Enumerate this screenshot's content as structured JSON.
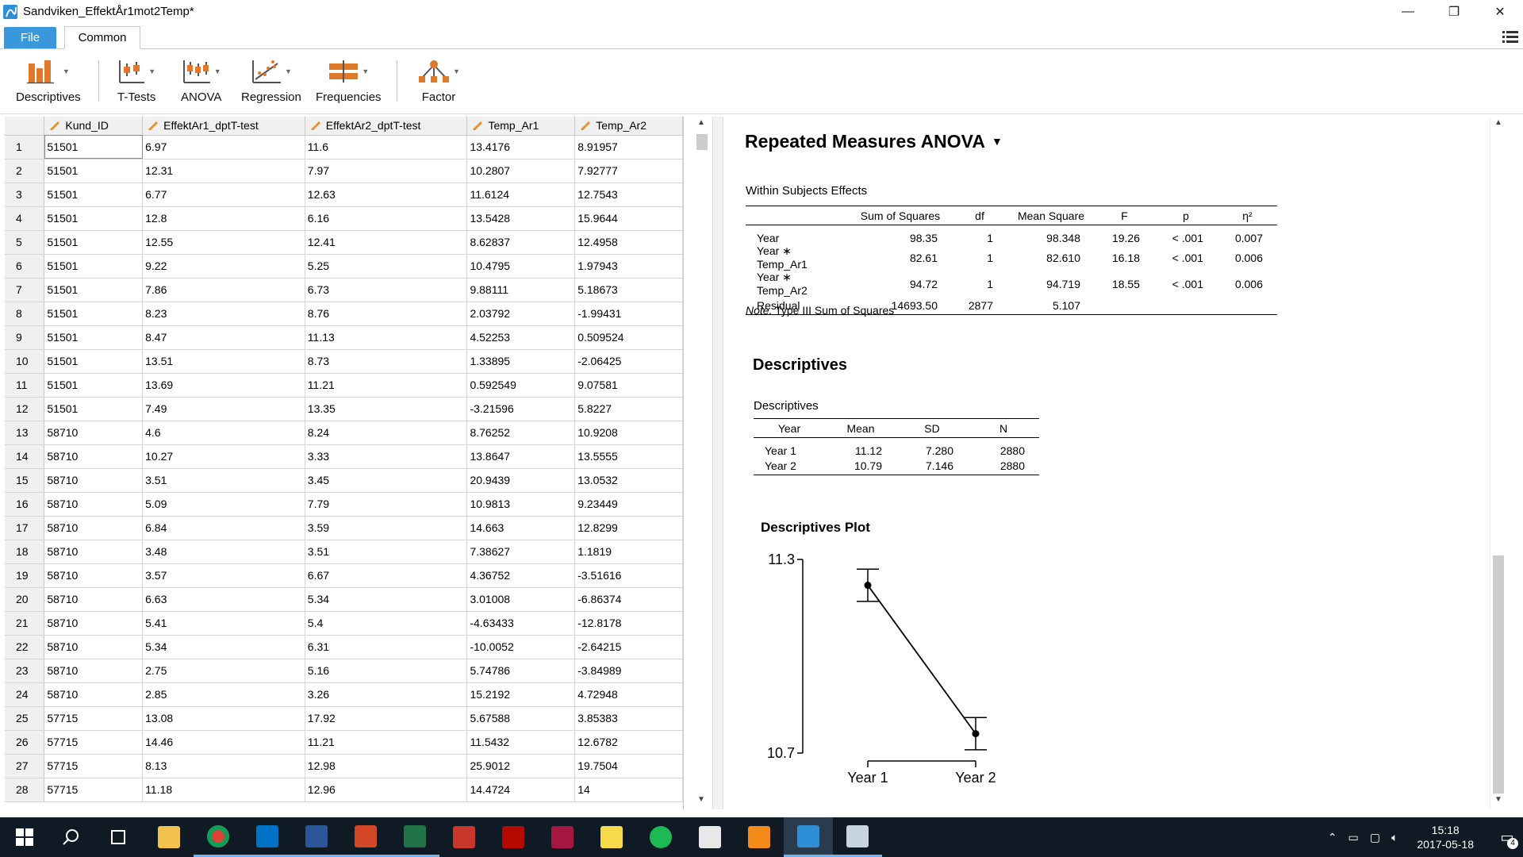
{
  "window": {
    "title": "Sandviken_EffektÅr1mot2Temp*",
    "minimize_glyph": "—",
    "maximize_glyph": "❐",
    "close_glyph": "✕"
  },
  "tabs": {
    "file": "File",
    "common": "Common"
  },
  "ribbon": {
    "descriptives": "Descriptives",
    "ttests": "T-Tests",
    "anova": "ANOVA",
    "regression": "Regression",
    "frequencies": "Frequencies",
    "factor": "Factor"
  },
  "grid": {
    "columns": [
      "Kund_ID",
      "EffektAr1_dptT-test",
      "EffektAr2_dptT-test",
      "Temp_Ar1",
      "Temp_Ar2"
    ],
    "rows": [
      [
        "1",
        "51501",
        "6.97",
        "11.6",
        "13.4176",
        "8.91957"
      ],
      [
        "2",
        "51501",
        "12.31",
        "7.97",
        "10.2807",
        "7.92777"
      ],
      [
        "3",
        "51501",
        "6.77",
        "12.63",
        "11.6124",
        "12.7543"
      ],
      [
        "4",
        "51501",
        "12.8",
        "6.16",
        "13.5428",
        "15.9644"
      ],
      [
        "5",
        "51501",
        "12.55",
        "12.41",
        "8.62837",
        "12.4958"
      ],
      [
        "6",
        "51501",
        "9.22",
        "5.25",
        "10.4795",
        "1.97943"
      ],
      [
        "7",
        "51501",
        "7.86",
        "6.73",
        "9.88111",
        "5.18673"
      ],
      [
        "8",
        "51501",
        "8.23",
        "8.76",
        "2.03792",
        "-1.99431"
      ],
      [
        "9",
        "51501",
        "8.47",
        "11.13",
        "4.52253",
        "0.509524"
      ],
      [
        "10",
        "51501",
        "13.51",
        "8.73",
        "1.33895",
        "-2.06425"
      ],
      [
        "11",
        "51501",
        "13.69",
        "11.21",
        "0.592549",
        "9.07581"
      ],
      [
        "12",
        "51501",
        "7.49",
        "13.35",
        "-3.21596",
        "5.8227"
      ],
      [
        "13",
        "58710",
        "4.6",
        "8.24",
        "8.76252",
        "10.9208"
      ],
      [
        "14",
        "58710",
        "10.27",
        "3.33",
        "13.8647",
        "13.5555"
      ],
      [
        "15",
        "58710",
        "3.51",
        "3.45",
        "20.9439",
        "13.0532"
      ],
      [
        "16",
        "58710",
        "5.09",
        "7.79",
        "10.9813",
        "9.23449"
      ],
      [
        "17",
        "58710",
        "6.84",
        "3.59",
        "14.663",
        "12.8299"
      ],
      [
        "18",
        "58710",
        "3.48",
        "3.51",
        "7.38627",
        "1.1819"
      ],
      [
        "19",
        "58710",
        "3.57",
        "6.67",
        "4.36752",
        "-3.51616"
      ],
      [
        "20",
        "58710",
        "6.63",
        "5.34",
        "3.01008",
        "-6.86374"
      ],
      [
        "21",
        "58710",
        "5.41",
        "5.4",
        "-4.63433",
        "-12.8178"
      ],
      [
        "22",
        "58710",
        "5.34",
        "6.31",
        "-10.0052",
        "-2.64215"
      ],
      [
        "23",
        "58710",
        "2.75",
        "5.16",
        "5.74786",
        "-3.84989"
      ],
      [
        "24",
        "58710",
        "2.85",
        "3.26",
        "15.2192",
        "4.72948"
      ],
      [
        "25",
        "57715",
        "13.08",
        "17.92",
        "5.67588",
        "3.85383"
      ],
      [
        "26",
        "57715",
        "14.46",
        "11.21",
        "11.5432",
        "12.6782"
      ],
      [
        "27",
        "57715",
        "8.13",
        "12.98",
        "25.9012",
        "19.7504"
      ],
      [
        "28",
        "57715",
        "11.18",
        "12.96",
        "14.4724",
        "14"
      ]
    ]
  },
  "results": {
    "title": "Repeated Measures ANOVA",
    "wse": {
      "caption": "Within Subjects Effects",
      "headers": [
        "",
        "Sum of Squares",
        "df",
        "Mean Square",
        "F",
        "p",
        "η²"
      ],
      "rows": [
        [
          "Year",
          "98.35",
          "1",
          "98.348",
          "19.26",
          "< .001",
          "0.007"
        ],
        [
          "Year ∗ Temp_Ar1",
          "82.61",
          "1",
          "82.610",
          "16.18",
          "< .001",
          "0.006"
        ],
        [
          "Year ∗ Temp_Ar2",
          "94.72",
          "1",
          "94.719",
          "18.55",
          "< .001",
          "0.006"
        ],
        [
          "Residual",
          "14693.50",
          "2877",
          "5.107",
          "",
          "",
          ""
        ]
      ],
      "note_label": "Note.",
      "note_text": " Type III Sum of Squares"
    },
    "desc_heading": "Descriptives",
    "desc": {
      "caption": "Descriptives",
      "headers": [
        "Year",
        "Mean",
        "SD",
        "N"
      ],
      "rows": [
        [
          "Year 1",
          "11.12",
          "7.280",
          "2880"
        ],
        [
          "Year 2",
          "10.79",
          "7.146",
          "2880"
        ]
      ]
    },
    "plot_title": "Descriptives Plot"
  },
  "chart_data": {
    "type": "line",
    "title": "Descriptives Plot",
    "categories": [
      "Year 1",
      "Year 2"
    ],
    "values": [
      11.22,
      10.76
    ],
    "error_low": [
      11.17,
      10.71
    ],
    "error_high": [
      11.27,
      10.81
    ],
    "ylim": [
      10.7,
      11.3
    ],
    "yticks": [
      "11.3",
      "10.7"
    ],
    "xlabel": "",
    "ylabel": ""
  },
  "taskbar": {
    "time": "15:18",
    "date": "2017-05-18",
    "notification_count": "4"
  }
}
